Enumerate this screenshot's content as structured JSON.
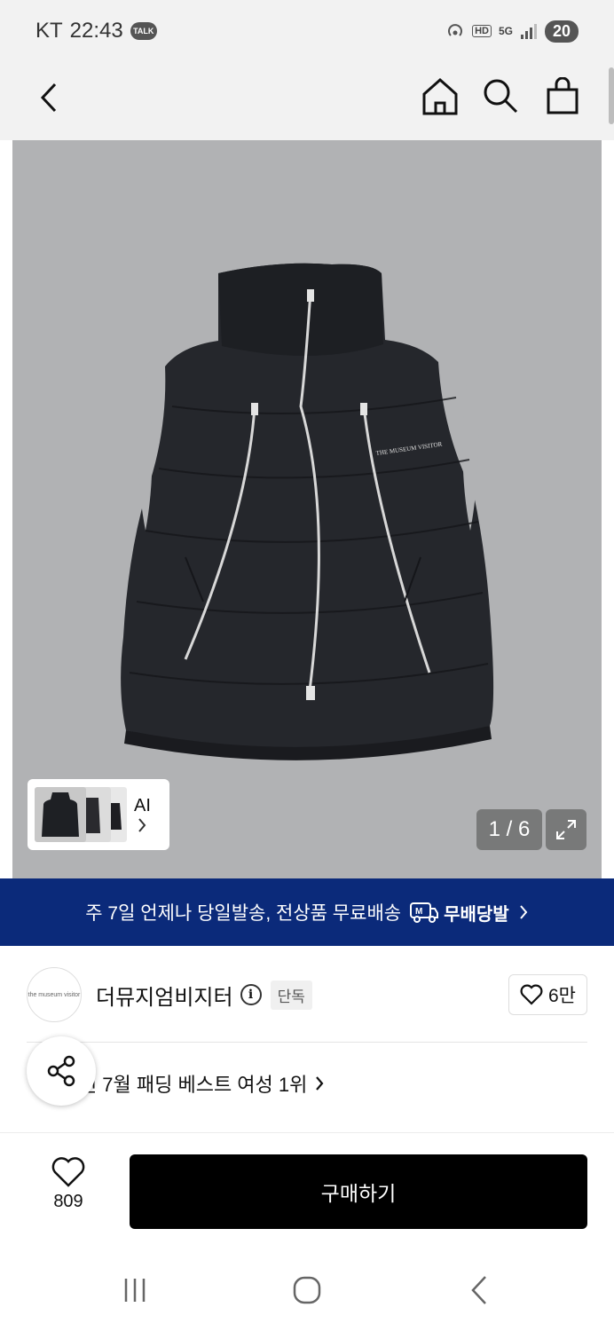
{
  "status_bar": {
    "carrier": "KT",
    "time": "22:43",
    "talk_badge": "TALK",
    "hd": "HD",
    "network": "5G",
    "battery": "20"
  },
  "header": {
    "back_icon": "back-arrow-icon",
    "home_icon": "home-icon",
    "search_icon": "search-icon",
    "cart_icon": "shopping-bag-icon"
  },
  "gallery": {
    "counter": "1 / 6",
    "ai_label": "AI",
    "wordmark": "THE MUSEUM VISITOR"
  },
  "banner": {
    "text": "주 7일 언제나 당일발송, 전상품 무료배송",
    "brand": "무배당발",
    "brand_badge": "M"
  },
  "brand": {
    "logo_text": "the museum visitor",
    "name": "더뮤지엄비지터",
    "tag": "단독",
    "like_count": "6만"
  },
  "ranking": {
    "text": "2024년 7월 패딩 베스트 여성 1위"
  },
  "bottom": {
    "wish_count": "809",
    "buy_label": "구매하기"
  },
  "colors": {
    "banner_bg": "#0b2a7a",
    "buy_bg": "#000000",
    "hero_bg": "#b1b2b4"
  }
}
